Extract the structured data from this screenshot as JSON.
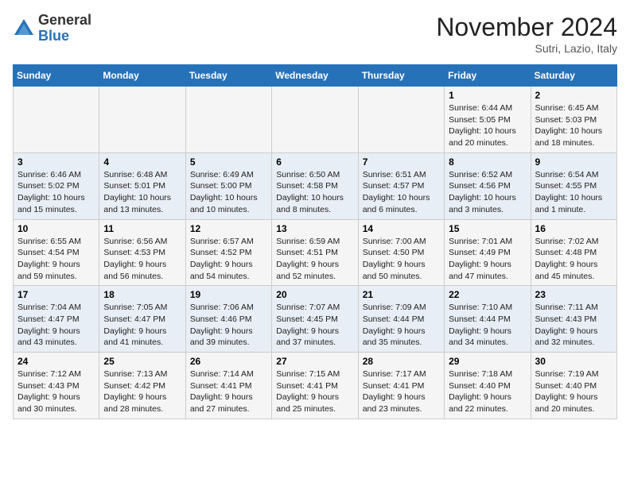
{
  "header": {
    "logo_line1": "General",
    "logo_line2": "Blue",
    "month_title": "November 2024",
    "location": "Sutri, Lazio, Italy"
  },
  "weekdays": [
    "Sunday",
    "Monday",
    "Tuesday",
    "Wednesday",
    "Thursday",
    "Friday",
    "Saturday"
  ],
  "weeks": [
    [
      {
        "day": "",
        "info": ""
      },
      {
        "day": "",
        "info": ""
      },
      {
        "day": "",
        "info": ""
      },
      {
        "day": "",
        "info": ""
      },
      {
        "day": "",
        "info": ""
      },
      {
        "day": "1",
        "info": "Sunrise: 6:44 AM\nSunset: 5:05 PM\nDaylight: 10 hours\nand 20 minutes."
      },
      {
        "day": "2",
        "info": "Sunrise: 6:45 AM\nSunset: 5:03 PM\nDaylight: 10 hours\nand 18 minutes."
      }
    ],
    [
      {
        "day": "3",
        "info": "Sunrise: 6:46 AM\nSunset: 5:02 PM\nDaylight: 10 hours\nand 15 minutes."
      },
      {
        "day": "4",
        "info": "Sunrise: 6:48 AM\nSunset: 5:01 PM\nDaylight: 10 hours\nand 13 minutes."
      },
      {
        "day": "5",
        "info": "Sunrise: 6:49 AM\nSunset: 5:00 PM\nDaylight: 10 hours\nand 10 minutes."
      },
      {
        "day": "6",
        "info": "Sunrise: 6:50 AM\nSunset: 4:58 PM\nDaylight: 10 hours\nand 8 minutes."
      },
      {
        "day": "7",
        "info": "Sunrise: 6:51 AM\nSunset: 4:57 PM\nDaylight: 10 hours\nand 6 minutes."
      },
      {
        "day": "8",
        "info": "Sunrise: 6:52 AM\nSunset: 4:56 PM\nDaylight: 10 hours\nand 3 minutes."
      },
      {
        "day": "9",
        "info": "Sunrise: 6:54 AM\nSunset: 4:55 PM\nDaylight: 10 hours\nand 1 minute."
      }
    ],
    [
      {
        "day": "10",
        "info": "Sunrise: 6:55 AM\nSunset: 4:54 PM\nDaylight: 9 hours\nand 59 minutes."
      },
      {
        "day": "11",
        "info": "Sunrise: 6:56 AM\nSunset: 4:53 PM\nDaylight: 9 hours\nand 56 minutes."
      },
      {
        "day": "12",
        "info": "Sunrise: 6:57 AM\nSunset: 4:52 PM\nDaylight: 9 hours\nand 54 minutes."
      },
      {
        "day": "13",
        "info": "Sunrise: 6:59 AM\nSunset: 4:51 PM\nDaylight: 9 hours\nand 52 minutes."
      },
      {
        "day": "14",
        "info": "Sunrise: 7:00 AM\nSunset: 4:50 PM\nDaylight: 9 hours\nand 50 minutes."
      },
      {
        "day": "15",
        "info": "Sunrise: 7:01 AM\nSunset: 4:49 PM\nDaylight: 9 hours\nand 47 minutes."
      },
      {
        "day": "16",
        "info": "Sunrise: 7:02 AM\nSunset: 4:48 PM\nDaylight: 9 hours\nand 45 minutes."
      }
    ],
    [
      {
        "day": "17",
        "info": "Sunrise: 7:04 AM\nSunset: 4:47 PM\nDaylight: 9 hours\nand 43 minutes."
      },
      {
        "day": "18",
        "info": "Sunrise: 7:05 AM\nSunset: 4:47 PM\nDaylight: 9 hours\nand 41 minutes."
      },
      {
        "day": "19",
        "info": "Sunrise: 7:06 AM\nSunset: 4:46 PM\nDaylight: 9 hours\nand 39 minutes."
      },
      {
        "day": "20",
        "info": "Sunrise: 7:07 AM\nSunset: 4:45 PM\nDaylight: 9 hours\nand 37 minutes."
      },
      {
        "day": "21",
        "info": "Sunrise: 7:09 AM\nSunset: 4:44 PM\nDaylight: 9 hours\nand 35 minutes."
      },
      {
        "day": "22",
        "info": "Sunrise: 7:10 AM\nSunset: 4:44 PM\nDaylight: 9 hours\nand 34 minutes."
      },
      {
        "day": "23",
        "info": "Sunrise: 7:11 AM\nSunset: 4:43 PM\nDaylight: 9 hours\nand 32 minutes."
      }
    ],
    [
      {
        "day": "24",
        "info": "Sunrise: 7:12 AM\nSunset: 4:43 PM\nDaylight: 9 hours\nand 30 minutes."
      },
      {
        "day": "25",
        "info": "Sunrise: 7:13 AM\nSunset: 4:42 PM\nDaylight: 9 hours\nand 28 minutes."
      },
      {
        "day": "26",
        "info": "Sunrise: 7:14 AM\nSunset: 4:41 PM\nDaylight: 9 hours\nand 27 minutes."
      },
      {
        "day": "27",
        "info": "Sunrise: 7:15 AM\nSunset: 4:41 PM\nDaylight: 9 hours\nand 25 minutes."
      },
      {
        "day": "28",
        "info": "Sunrise: 7:17 AM\nSunset: 4:41 PM\nDaylight: 9 hours\nand 23 minutes."
      },
      {
        "day": "29",
        "info": "Sunrise: 7:18 AM\nSunset: 4:40 PM\nDaylight: 9 hours\nand 22 minutes."
      },
      {
        "day": "30",
        "info": "Sunrise: 7:19 AM\nSunset: 4:40 PM\nDaylight: 9 hours\nand 20 minutes."
      }
    ]
  ]
}
